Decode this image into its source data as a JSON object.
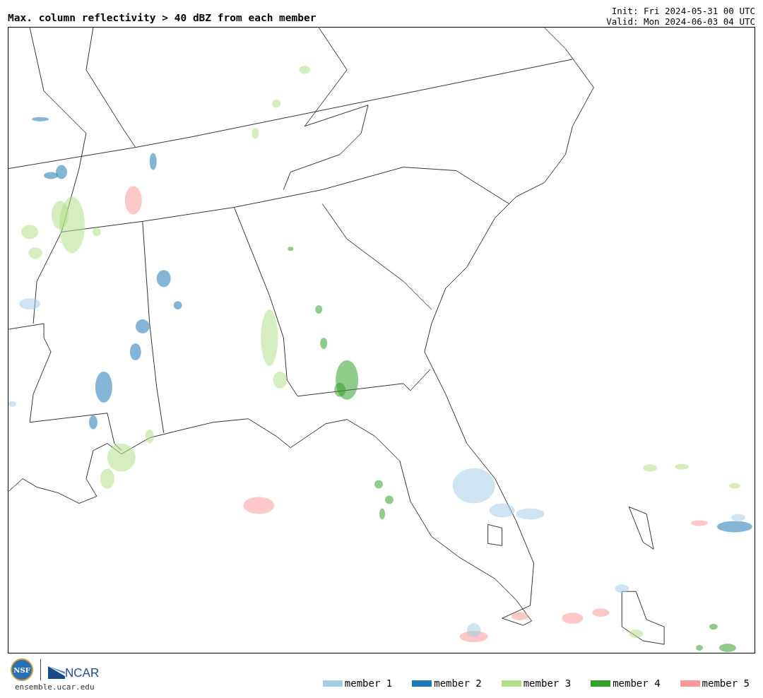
{
  "header": {
    "title": "Max. column reflectivity > 40 dBZ from each member",
    "init": "Init: Fri 2024-05-31 00 UTC",
    "valid": "Valid: Mon 2024-06-03 04 UTC"
  },
  "footer": {
    "logos": [
      {
        "kind": "nsf",
        "text": "NSF"
      },
      {
        "kind": "ncar",
        "text": "NCAR"
      }
    ],
    "site": "ensemble.ucar.edu"
  },
  "legend": [
    {
      "label": "member 1",
      "color": "#a6cee3"
    },
    {
      "label": "member 2",
      "color": "#1f78b4"
    },
    {
      "label": "member 3",
      "color": "#b2df8a"
    },
    {
      "label": "member 4",
      "color": "#33a02c"
    },
    {
      "label": "member 5",
      "color": "#fb9a99"
    }
  ]
}
